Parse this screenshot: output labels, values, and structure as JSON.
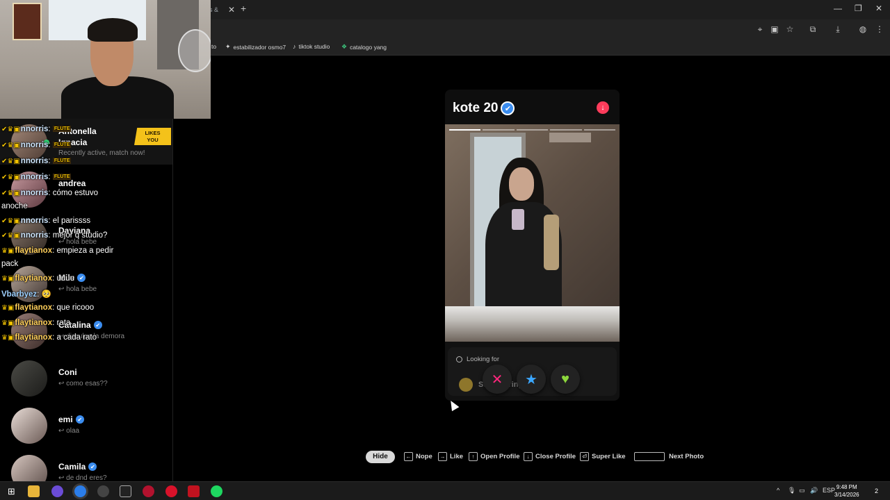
{
  "browser": {
    "tab_title": "ds & ",
    "tab_close": "✕",
    "new_tab": "+",
    "window_controls": [
      "—",
      "❐",
      "✕"
    ],
    "toolbar_icons": [
      "location-icon",
      "cast-icon",
      "star-icon",
      "extensions-icon",
      "download-icon",
      "profile-icon",
      "menu-icon"
    ],
    "bookmarks": [
      {
        "label": "to",
        "icon": ""
      },
      {
        "label": "estabilizador osmo7",
        "icon": "✦"
      },
      {
        "label": "tiktok studio",
        "icon": "♪"
      },
      {
        "label": "catalogo yang",
        "icon": "❖"
      }
    ]
  },
  "sidebar": {
    "top_match": {
      "name_line1": "Antonella",
      "name_line2": "Ignacia",
      "status": "Recently active, match now!",
      "badge_line1": "LIKES",
      "badge_line2": "YOU"
    },
    "matches": [
      {
        "name": "andrea",
        "verified": false,
        "message": ""
      },
      {
        "name": "Dayiana",
        "verified": false,
        "message": "↩ hola bebe"
      },
      {
        "name": "Mile",
        "verified": true,
        "message": "↩ hola bebe"
      },
      {
        "name": "Catalina",
        "verified": true,
        "message": "↩ disculpa la demora"
      },
      {
        "name": "Coni",
        "verified": false,
        "message": "↩ como esas??"
      },
      {
        "name": "emi",
        "verified": true,
        "message": "↩ olaa"
      },
      {
        "name": "Camila",
        "verified": true,
        "message": "↩ de dnd eres?"
      }
    ]
  },
  "chat": {
    "lines": [
      {
        "badges": "✔♛▣",
        "user": "nnorris",
        "text": ":",
        "emote": "FLUTE"
      },
      {
        "badges": "✔♛▣",
        "user": "nnorris",
        "text": ":",
        "emote": "FLUTE"
      },
      {
        "badges": "✔♛▣",
        "user": "nnorris",
        "text": ":",
        "emote": "FLUTE"
      },
      {
        "badges": "✔♛▣",
        "user": "nnorris",
        "text": ":",
        "emote": "FLUTE"
      },
      {
        "badges": "✔♛▣",
        "user": "nnorris",
        "text": ": cómo estuvo",
        "emote": ""
      },
      {
        "badges": "",
        "user": "",
        "text": "anoche",
        "emote": ""
      },
      {
        "badges": "✔♛▣",
        "user": "nnorris",
        "text": ": el parissss",
        "emote": ""
      },
      {
        "badges": "✔♛▣",
        "user": "nnorris",
        "text": ": mejor q studio?",
        "emote": ""
      },
      {
        "badges": "♛▣",
        "user": "flaytianox",
        "text": ": empieza a pedir",
        "emote": ""
      },
      {
        "badges": "",
        "user": "",
        "text": "pack",
        "emote": ""
      },
      {
        "badges": "♛▣",
        "user": "flaytianox",
        "text": ": uuuu",
        "emote": ""
      },
      {
        "badges": "",
        "user": "Vbarbyez",
        "text": ": 🥺",
        "emote": ""
      },
      {
        "badges": "♛▣",
        "user": "flaytianox",
        "text": ": que ricooo",
        "emote": ""
      },
      {
        "badges": "♛▣",
        "user": "flaytianox",
        "text": ": rata",
        "emote": ""
      },
      {
        "badges": "♛▣",
        "user": "flaytianox",
        "text": ": a cada rato",
        "emote": ""
      }
    ]
  },
  "card": {
    "name_age": "kote 20",
    "verified_glyph": "✔",
    "collapse_glyph": "↓",
    "photo_count": 5,
    "active_photo": 0,
    "looking_for_label": "Looking for",
    "looking_for_value": "Still figuring it out",
    "actions": {
      "nope": "✕",
      "super_like": "★",
      "like": "♥"
    }
  },
  "hints": {
    "hide": "Hide",
    "items": [
      {
        "key": "←",
        "label": "Nope"
      },
      {
        "key": "→",
        "label": "Like"
      },
      {
        "key": "↑",
        "label": "Open Profile"
      },
      {
        "key": "↓",
        "label": "Close Profile"
      },
      {
        "key": "⏎",
        "label": "Super Like"
      },
      {
        "key": "",
        "label": "Next Photo"
      }
    ]
  },
  "taskbar": {
    "language": "ESP",
    "time": "9:48 PM",
    "date": "3/14/2026",
    "notifications": "2"
  },
  "colors": {
    "tinder_pink": "#fe3c5b",
    "nope": "#fd267d",
    "super_like": "#3ba7ff",
    "like": "#8cd73c",
    "likes_badge": "#f4c21a",
    "verified": "#3b8df0"
  }
}
